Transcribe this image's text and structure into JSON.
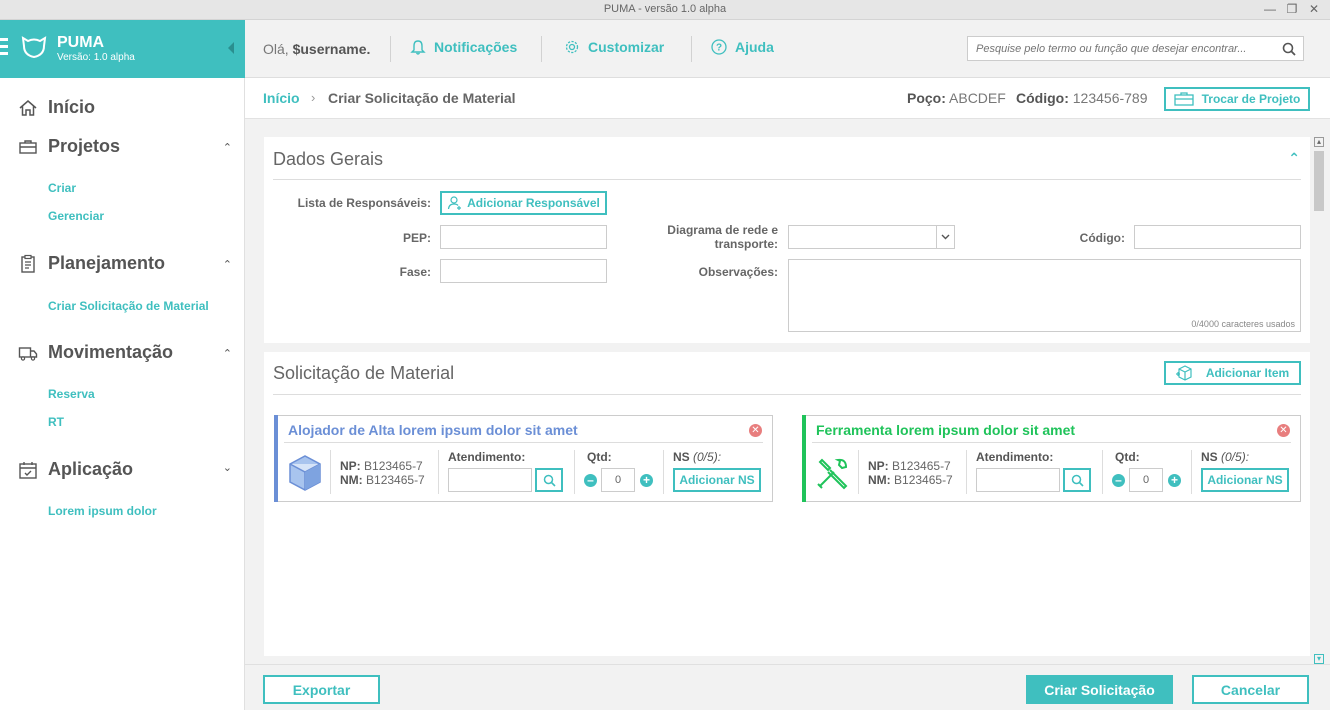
{
  "window": {
    "title": "PUMA - versão 1.0 alpha"
  },
  "brand": {
    "name": "PUMA",
    "version": "Versão: 1.0 alpha"
  },
  "header": {
    "greeting_prefix": "Olá,",
    "username": "$username.",
    "notifications": "Notificações",
    "customize": "Customizar",
    "help": "Ajuda"
  },
  "search": {
    "placeholder": "Pesquise pelo termo ou função que desejar encontrar..."
  },
  "sidebar": {
    "home": "Início",
    "projects": {
      "label": "Projetos",
      "items": [
        "Criar",
        "Gerenciar"
      ]
    },
    "planning": {
      "label": "Planejamento",
      "items": [
        "Criar Solicitação de Material"
      ]
    },
    "movement": {
      "label": "Movimentação",
      "items": [
        "Reserva",
        "RT"
      ]
    },
    "application": {
      "label": "Aplicação",
      "items": [
        "Lorem ipsum dolor"
      ]
    }
  },
  "breadcrumb": {
    "home": "Início",
    "current": "Criar Solicitação de Material"
  },
  "project_info": {
    "poco_label": "Poço:",
    "poco_value": "ABCDEF",
    "codigo_label": "Código:",
    "codigo_value": "123456-789",
    "switch_button": "Trocar de Projeto"
  },
  "general": {
    "title": "Dados Gerais",
    "responsaveis_label": "Lista de Responsáveis:",
    "add_responsavel": "Adicionar Responsável",
    "pep_label": "PEP:",
    "pep_value": "",
    "fase_label": "Fase:",
    "fase_value": "",
    "diagrama_label_1": "Diagrama de rede e",
    "diagrama_label_2": "transporte:",
    "diagrama_value": "",
    "codigo_label": "Código:",
    "codigo_value": "",
    "obs_label": "Observações:",
    "obs_value": "",
    "obs_counter": "0/4000 caracteres usados"
  },
  "material": {
    "title": "Solicitação de Material",
    "add_item": "Adicionar Item",
    "items": [
      {
        "title": "Alojador de Alta lorem ipsum dolor sit amet",
        "color": "#6b8fd6",
        "icon": "box-icon",
        "np_label": "NP:",
        "np": "B123465-7",
        "nm_label": "NM:",
        "nm": "B123465-7",
        "att_label": "Atendimento:",
        "qty_label": "Qtd:",
        "qty": "0",
        "ns_label": "NS",
        "ns_count": "(0/5):",
        "ns_button": "Adicionar NS"
      },
      {
        "title": "Ferramenta lorem ipsum dolor sit amet",
        "color": "#1fc35a",
        "icon": "tools-icon",
        "np_label": "NP:",
        "np": "B123465-7",
        "nm_label": "NM:",
        "nm": "B123465-7",
        "att_label": "Atendimento:",
        "qty_label": "Qtd:",
        "qty": "0",
        "ns_label": "NS",
        "ns_count": "(0/5):",
        "ns_button": "Adicionar NS"
      }
    ]
  },
  "footer": {
    "export": "Exportar",
    "create": "Criar Solicitação",
    "cancel": "Cancelar"
  },
  "colors": {
    "accent": "#3fbfbf",
    "item_blue": "#6b8fd6",
    "item_green": "#1fc35a",
    "danger": "#e87e7e"
  }
}
